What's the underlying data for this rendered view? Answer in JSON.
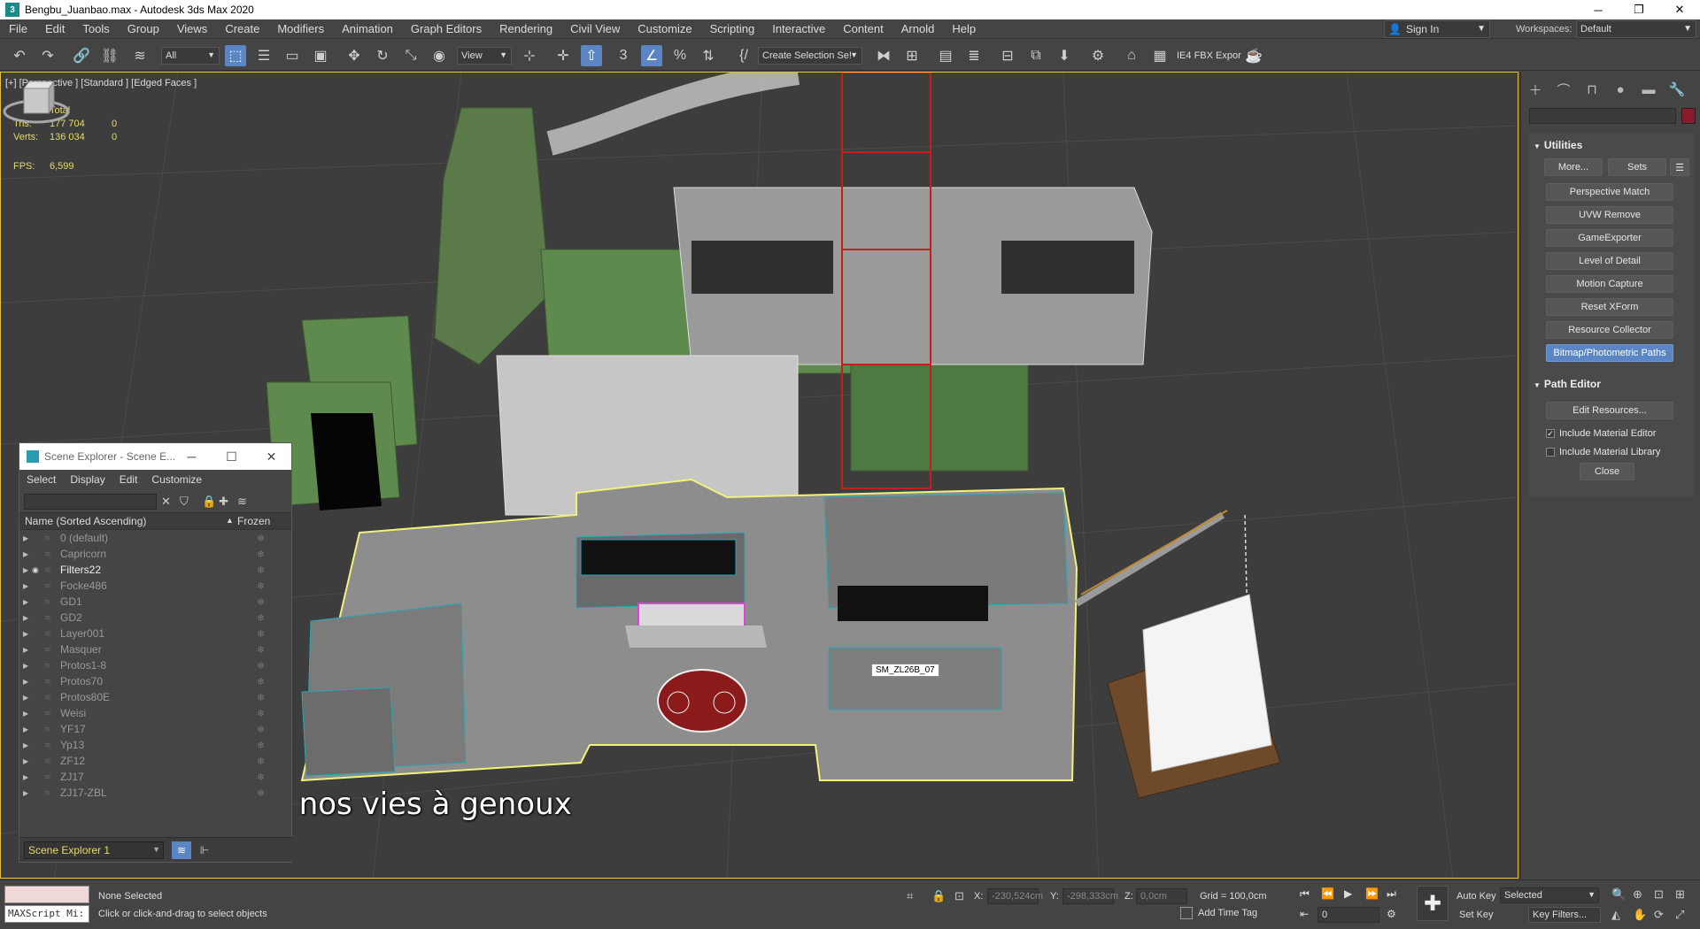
{
  "window": {
    "title": "Bengbu_Juanbao.max - Autodesk 3ds Max 2020",
    "controls": [
      "─",
      "❐",
      "✕"
    ]
  },
  "menu": [
    "File",
    "Edit",
    "Tools",
    "Group",
    "Views",
    "Create",
    "Modifiers",
    "Animation",
    "Graph Editors",
    "Rendering",
    "Civil View",
    "Customize",
    "Scripting",
    "Interactive",
    "Content",
    "Arnold",
    "Help"
  ],
  "signin": "Sign In",
  "workspaces": {
    "label": "Workspaces:",
    "value": "Default"
  },
  "toolbar": {
    "filter_value": "All",
    "view_value": "View",
    "selection_set": "Create Selection Se!",
    "fbx_label": "IE4 FBX Expor"
  },
  "viewport": {
    "label": "[+] [Perspective ] [Standard ] [Edged Faces ]",
    "stats": {
      "header": "Total",
      "rows": [
        {
          "k": "Tris:",
          "v": "177 704",
          "v2": "0"
        },
        {
          "k": "Verts:",
          "v": "136 034",
          "v2": "0"
        }
      ],
      "fps_label": "FPS:",
      "fps_value": "6,599"
    },
    "tooltip": "SM_ZL26B_07",
    "subtitle": "est pour faire nos vies à genoux",
    "colors": {
      "background": "#3d3d3d",
      "selection": "#f2f27a",
      "wire": "#2aa7b8",
      "frame": "#e5c04a"
    }
  },
  "scene_explorer": {
    "title": "Scene Explorer - Scene E...",
    "menu": [
      "Select",
      "Display",
      "Edit",
      "Customize"
    ],
    "header_name": "Name (Sorted Ascending)",
    "header_sort": "▲",
    "header_frozen": "Frozen",
    "rows": [
      {
        "label": "0 (default)",
        "visible": false
      },
      {
        "label": "Capricorn",
        "visible": false
      },
      {
        "label": "Filters22",
        "visible": true
      },
      {
        "label": "Focke486",
        "visible": false
      },
      {
        "label": "GD1",
        "visible": false
      },
      {
        "label": "GD2",
        "visible": false
      },
      {
        "label": "Layer001",
        "visible": false
      },
      {
        "label": "Masquer",
        "visible": false
      },
      {
        "label": "Protos1-8",
        "visible": false
      },
      {
        "label": "Protos70",
        "visible": false
      },
      {
        "label": "Protos80E",
        "visible": false
      },
      {
        "label": "Weisi",
        "visible": false
      },
      {
        "label": "YF17",
        "visible": false
      },
      {
        "label": "Yp13",
        "visible": false
      },
      {
        "label": "ZF12",
        "visible": false
      },
      {
        "label": "ZJ17",
        "visible": false
      },
      {
        "label": "ZJ17-ZBL",
        "visible": false
      }
    ],
    "footer_select": "Scene Explorer 1"
  },
  "command_panel": {
    "utilities_title": "Utilities",
    "more": "More...",
    "sets": "Sets",
    "utilities": [
      {
        "label": "Perspective Match",
        "active": false
      },
      {
        "label": "UVW Remove",
        "active": false
      },
      {
        "label": "GameExporter",
        "active": false
      },
      {
        "label": "Level of Detail",
        "active": false
      },
      {
        "label": "Motion Capture",
        "active": false
      },
      {
        "label": "Reset XForm",
        "active": false
      },
      {
        "label": "Resource Collector",
        "active": false
      },
      {
        "label": "Bitmap/Photometric Paths",
        "active": true
      }
    ],
    "path_editor_title": "Path Editor",
    "edit_resources": "Edit Resources...",
    "include_material_editor": "Include Material Editor",
    "include_material_library": "Include Material Library",
    "close": "Close",
    "object_color": "#8a1a2e"
  },
  "status": {
    "maxscript": "MAXScript Mi:",
    "selection": "None Selected",
    "prompt": "Click or click-and-drag to select objects",
    "x_label": "X:",
    "x_value": "-230,524cm",
    "y_label": "Y:",
    "y_value": "-298,333cm",
    "z_label": "Z:",
    "z_value": "0,0cm",
    "grid": "Grid = 100,0cm",
    "add_time_tag": "Add Time Tag",
    "frame": "0",
    "auto_key": "Auto Key",
    "set_key": "Set Key",
    "key_mode": "Selected",
    "key_filters": "Key Filters..."
  }
}
